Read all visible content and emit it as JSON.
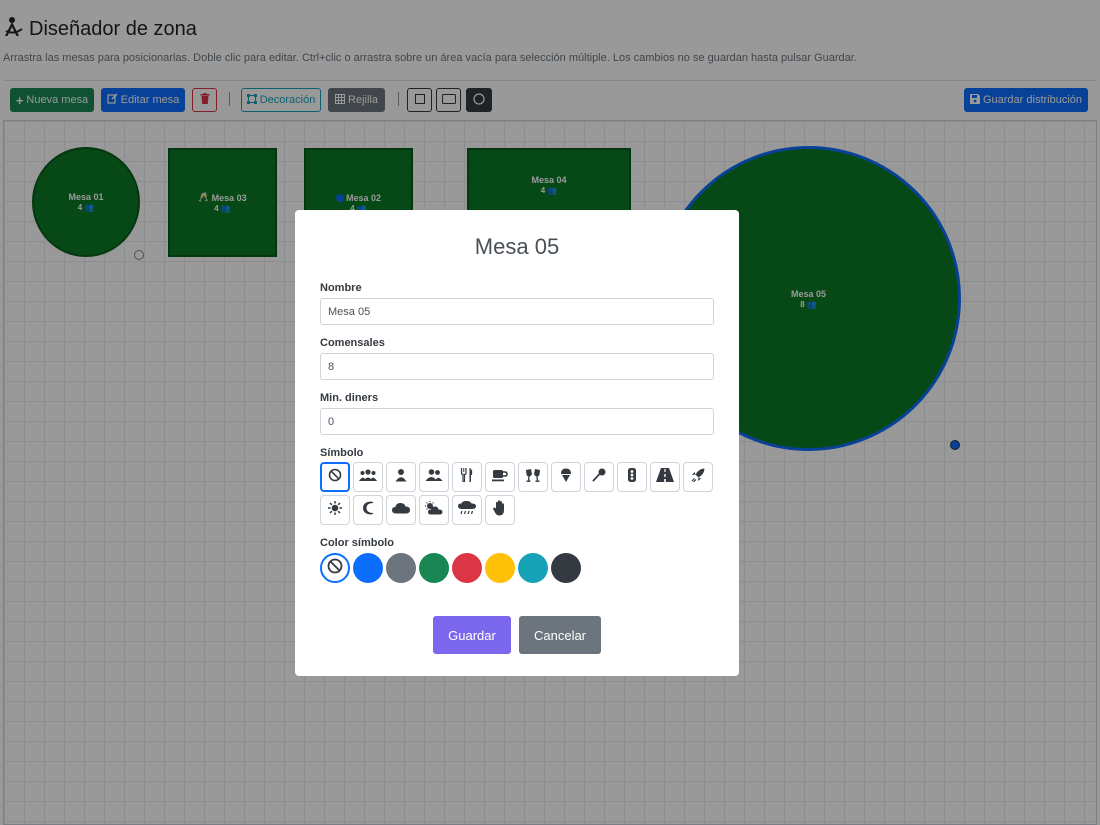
{
  "header": {
    "title": "Diseñador de zona",
    "subtitle": "Arrastra las mesas para posicionarlas. Doble clic para editar. Ctrl+clic o arrastra sobre un área vacía para selección múltiple. Los cambios no se guardan hasta pulsar Guardar."
  },
  "toolbar": {
    "new_table": "Nueva mesa",
    "edit_table": "Editar mesa",
    "decoration": "Decoración",
    "grid": "Rejilla",
    "save_layout": "Guardar distribución"
  },
  "tables": [
    {
      "name": "Mesa 01",
      "diners": "4"
    },
    {
      "name": "Mesa 03",
      "diners": "4"
    },
    {
      "name": "Mesa 02",
      "diners": "4"
    },
    {
      "name": "Mesa 04",
      "diners": "4"
    },
    {
      "name": "Mesa 05",
      "diners": "8"
    }
  ],
  "modal": {
    "title": "Mesa 05",
    "name_label": "Nombre",
    "name_value": "Mesa 05",
    "diners_label": "Comensales",
    "diners_value": "8",
    "min_label": "Min. diners",
    "min_value": "0",
    "symbol_label": "Símbolo",
    "symbols": [
      "none",
      "users",
      "user",
      "user-group",
      "utensils",
      "coffee",
      "glasses-cheers",
      "ice-cream",
      "microphone",
      "traffic-light",
      "road",
      "rocket",
      "sun",
      "moon",
      "cloud",
      "cloud-sun",
      "cloud-rain",
      "hand"
    ],
    "selected_symbol": "none",
    "color_label": "Color símbolo",
    "colors": [
      "none",
      "#0d6efd",
      "#6c757d",
      "#198754",
      "#dc3545",
      "#ffc107",
      "#17a2b8",
      "#343a40"
    ],
    "selected_color": "none",
    "save": "Guardar",
    "cancel": "Cancelar"
  },
  "colors": {
    "table_fill": "#0b7a27",
    "save_button": "#7b68ee",
    "cancel_button": "#6c757d"
  }
}
